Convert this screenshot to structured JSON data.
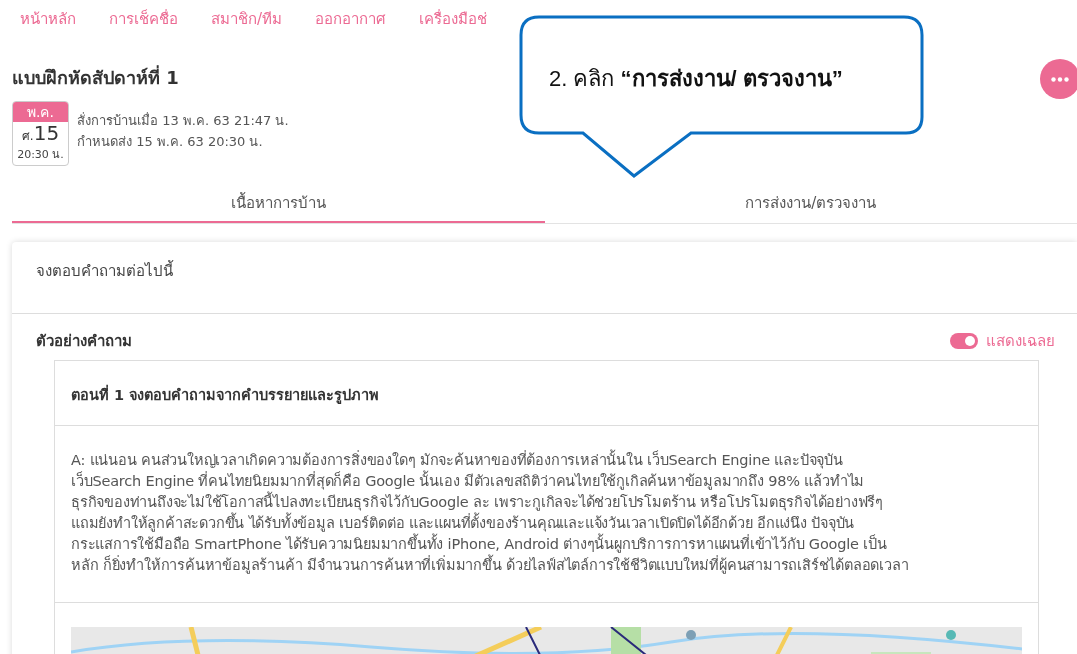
{
  "nav": [
    {
      "label": "หน้าหลัก"
    },
    {
      "label": "การเช็คชื่อ"
    },
    {
      "label": "สมาชิก/ทีม"
    },
    {
      "label": "ออกอากาศ"
    },
    {
      "label": "เครื่องมือช่"
    }
  ],
  "callout": {
    "text": "2. คลิก **“การส่งงาน/ ตรวจงาน”**"
  },
  "assignment": {
    "title": "แบบฝึกหัดสัปดาห์ที่ 1",
    "date_badge": {
      "month": "พ.ค.",
      "day_prefix": "ศ.",
      "day": "15",
      "time": "20:30 น."
    },
    "assigned": "สั่งการบ้านเมื่อ 13 พ.ค. 63 21:47 น.",
    "due": "กำหนดส่ง 15 พ.ค. 63 20:30 น."
  },
  "tabs": [
    {
      "label": "เนื้อหาการบ้าน",
      "selected": true
    },
    {
      "label": "การส่งงาน/ตรวจงาน",
      "selected": false
    }
  ],
  "instruction": "จงตอบคำถามต่อไปนี้",
  "example": {
    "heading": "ตัวอย่างคำถาม",
    "show_answer": {
      "label": "แสดงเฉลย",
      "on": true
    },
    "part_title": "ตอนที่ 1 จงตอบคำถามจากคำบรรยายและรูปภาพ",
    "paragraph_lines": [
      "A: แน่นอน คนส่วนใหญ่เวลาเกิดความต้องการสิ่งของใดๆ มักจะค้นหาของที่ต้องการเหล่านั้นใน เว็บSearch Engine และปัจจุบัน",
      "เว็บSearch Engine ที่คนไทยนิยมมากที่สุดก็คือ Google นั้นเอง มีตัวเลขสถิติว่าคนไทยใช้กูเกิลค้นหาข้อมูลมากถึง 98% แล้วทำไม",
      "ธุรกิจของท่านถึงจะไม่ใช้โอกาสนี้ไปลงทะเบียนธุรกิจไว้กับGoogle ละ เพราะกูเกิลจะได้ช่วยโปรโมตร้าน หรือโปรโมตธุรกิจได้อย่างฟรีๆ",
      "แถมยังทำให้ลูกค้าสะดวกขึ้น ได้รับทั้งข้อมูล เบอร์ติดต่อ และแผนที่ตั้งของร้านคุณและแจ้งวันเวลาเปิดปิดได้อีกด้วย อีกแง่นึง ปัจจุบัน",
      "กระแสการใช้มือถือ SmartPhone ได้รับความนิยมมากขึ้นทั้ง iPhone, Android ต่างๆนั้นผูกบริการการหาแผนที่เข้าไว้กับ Google เป็น",
      "หลัก ก็ยิ่งทำให้การค้นหาข้อมูลร้านค้า มีจำนวนการค้นหาที่เพิ่มมากขึ้น ด้วยไลฟ์สไตล์การใช้ชีวิตแบบใหม่ที่ผู้คนสามารถเสิร์ชได้ตลอดเวลา"
    ]
  }
}
